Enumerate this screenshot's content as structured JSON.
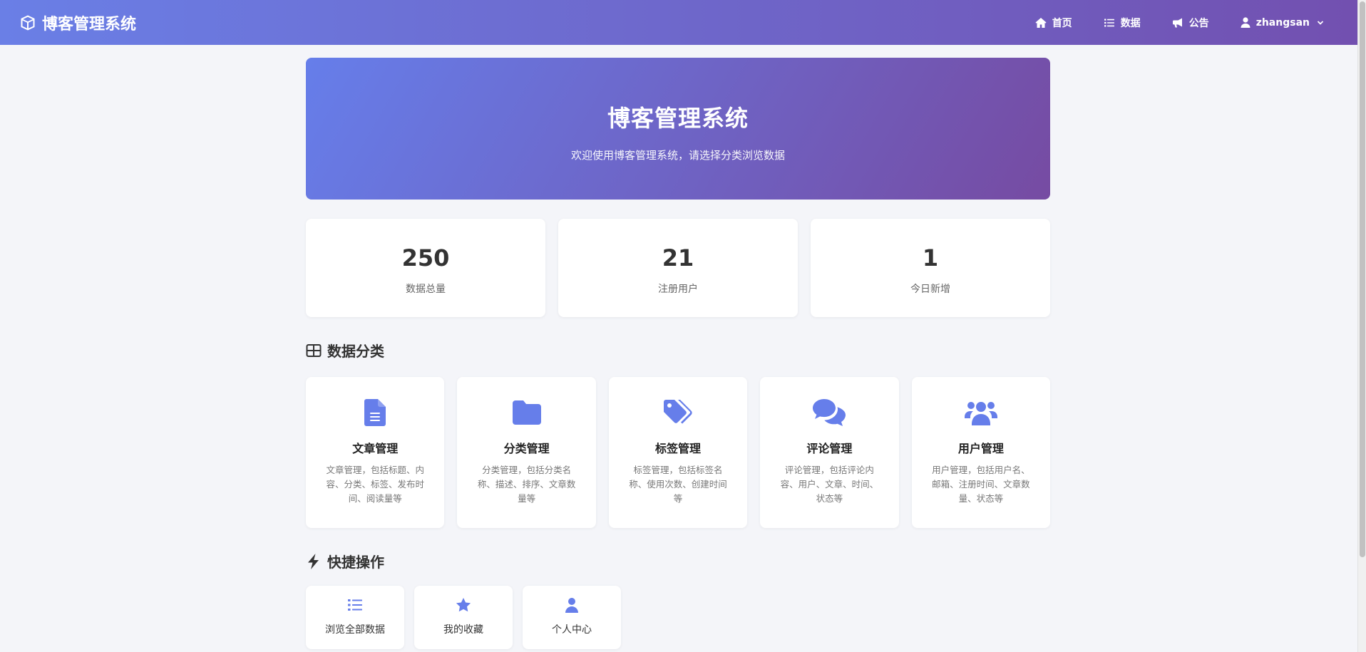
{
  "navbar": {
    "brand": "博客管理系统",
    "brand_icon": "cube-icon",
    "links": [
      {
        "label": "首页",
        "icon": "home-icon"
      },
      {
        "label": "数据",
        "icon": "list-icon"
      },
      {
        "label": "公告",
        "icon": "bullhorn-icon"
      }
    ],
    "user": {
      "name": "zhangsan",
      "icon": "user-icon"
    }
  },
  "hero": {
    "title": "博客管理系统",
    "subtitle": "欢迎使用博客管理系统，请选择分类浏览数据"
  },
  "stats": [
    {
      "value": "250",
      "label": "数据总量"
    },
    {
      "value": "21",
      "label": "注册用户"
    },
    {
      "value": "1",
      "label": "今日新增"
    }
  ],
  "categories_section": {
    "title": "数据分类",
    "icon": "table-icon",
    "items": [
      {
        "title": "文章管理",
        "desc": "文章管理，包括标题、内容、分类、标签、发布时间、阅读量等",
        "icon": "file-icon"
      },
      {
        "title": "分类管理",
        "desc": "分类管理，包括分类名称、描述、排序、文章数量等",
        "icon": "folder-icon"
      },
      {
        "title": "标签管理",
        "desc": "标签管理，包括标签名称、使用次数、创建时间等",
        "icon": "tags-icon"
      },
      {
        "title": "评论管理",
        "desc": "评论管理，包括评论内容、用户、文章、时间、状态等",
        "icon": "comments-icon"
      },
      {
        "title": "用户管理",
        "desc": "用户管理，包括用户名、邮箱、注册时间、文章数量、状态等",
        "icon": "users-icon"
      }
    ]
  },
  "quick_section": {
    "title": "快捷操作",
    "icon": "bolt-icon",
    "items": [
      {
        "label": "浏览全部数据",
        "icon": "list-icon"
      },
      {
        "label": "我的收藏",
        "icon": "star-icon"
      },
      {
        "label": "个人中心",
        "icon": "user-icon"
      }
    ]
  },
  "colors": {
    "accent": "#667eea",
    "accent_dark": "#764ba2",
    "background": "#f4f5f9"
  }
}
